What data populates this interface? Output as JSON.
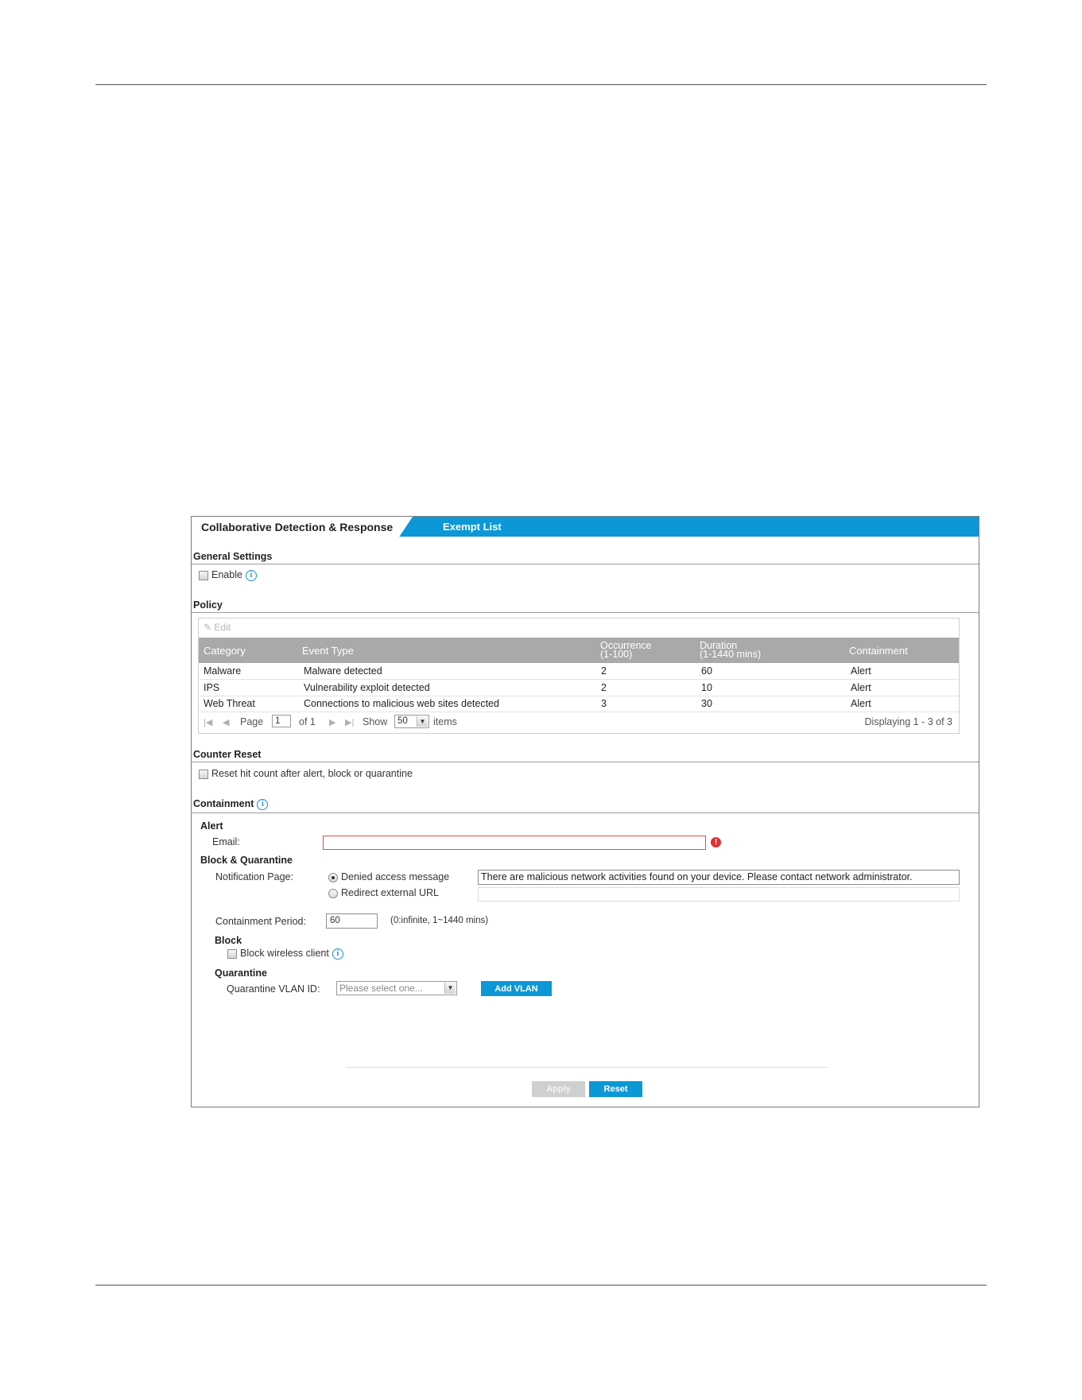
{
  "tabs": {
    "active": "Collaborative Detection & Response",
    "inactive": "Exempt List"
  },
  "general": {
    "title": "General Settings",
    "enable_label": "Enable"
  },
  "policy": {
    "title": "Policy",
    "edit_label": "Edit",
    "columns": {
      "category": "Category",
      "event_type": "Event Type",
      "occurrence": "Occurrence",
      "occurrence_range": "(1-100)",
      "duration": "Duration",
      "duration_range": "(1-1440 mins)",
      "containment": "Containment"
    },
    "rows": [
      {
        "category": "Malware",
        "event_type": "Malware detected",
        "occurrence": "2",
        "duration": "60",
        "containment": "Alert"
      },
      {
        "category": "IPS",
        "event_type": "Vulnerability exploit detected",
        "occurrence": "2",
        "duration": "10",
        "containment": "Alert"
      },
      {
        "category": "Web Threat",
        "event_type": "Connections to malicious web sites detected",
        "occurrence": "3",
        "duration": "30",
        "containment": "Alert"
      }
    ],
    "pager": {
      "page_label": "Page",
      "page_value": "1",
      "of_label": "of 1",
      "show_label": "Show",
      "show_value": "50",
      "items_label": "items",
      "displaying": "Displaying 1 - 3 of 3"
    }
  },
  "counter": {
    "title": "Counter Reset",
    "reset_label": "Reset hit count after alert, block or quarantine"
  },
  "containment": {
    "title": "Containment",
    "alert_title": "Alert",
    "email_label": "Email:",
    "email_value": "",
    "block_quarantine_title": "Block & Quarantine",
    "notification_label": "Notification Page:",
    "denied_label": "Denied access message",
    "redirect_label": "Redirect external URL",
    "denied_message": "There are malicious network activities found on your device. Please contact network administrator.",
    "redirect_url": "",
    "period_label": "Containment Period:",
    "period_value": "60",
    "period_hint": "(0:infinite, 1~1440 mins)",
    "block_title": "Block",
    "block_wireless_label": "Block wireless client",
    "quarantine_title": "Quarantine",
    "vlan_label": "Quarantine VLAN ID:",
    "vlan_placeholder": "Please select one...",
    "add_vlan_label": "Add VLAN"
  },
  "footer": {
    "apply_label": "Apply",
    "reset_label": "Reset"
  },
  "colors": {
    "accent": "#0c97d6",
    "header_gray": "#a9a9a9",
    "error": "#e03030"
  }
}
